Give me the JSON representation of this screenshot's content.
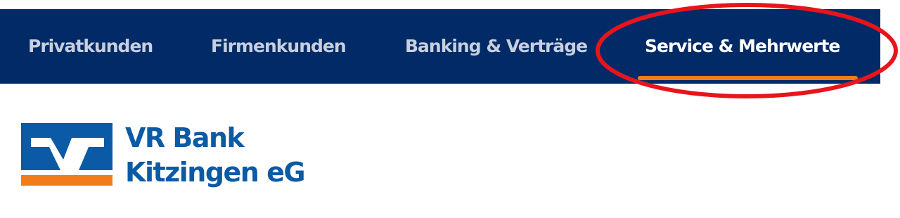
{
  "nav": {
    "items": [
      {
        "label": "Privatkunden"
      },
      {
        "label": "Firmenkunden"
      },
      {
        "label": "Banking & Verträge"
      },
      {
        "label": "Service & Mehrwerte"
      }
    ],
    "active_index": 3
  },
  "brand": {
    "name_line1": "VR Bank",
    "name_line2": "Kitzingen eG"
  },
  "colors": {
    "nav_background": "#012a66",
    "nav_text": "#c7cfde",
    "nav_text_active": "#ffffff",
    "accent_orange": "#f07c1a",
    "brand_blue": "#0b5aa6",
    "annotation_red": "#e8141c"
  }
}
